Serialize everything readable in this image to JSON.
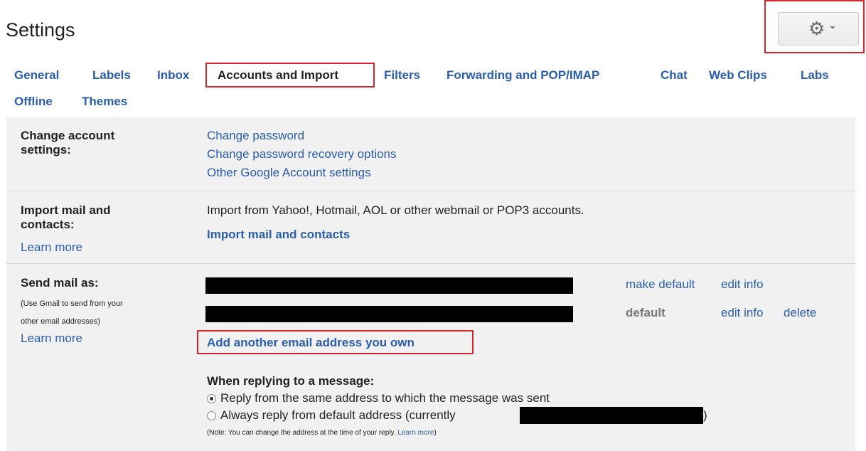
{
  "header": {
    "title": "Settings"
  },
  "nav": {
    "tabs": [
      "General",
      "Labels",
      "Inbox",
      "Accounts and Import",
      "Filters",
      "Forwarding and POP/IMAP",
      "Chat",
      "Web Clips",
      "Labs",
      "Offline",
      "Themes"
    ],
    "active": "Accounts and Import"
  },
  "change_account": {
    "label": "Change account settings:",
    "links": [
      "Change password",
      "Change password recovery options",
      "Other Google Account settings"
    ]
  },
  "import": {
    "label": "Import mail and contacts:",
    "learn_more": "Learn more",
    "description": "Import from Yahoo!, Hotmail, AOL or other webmail or POP3 accounts.",
    "action": "Import mail and contacts"
  },
  "send_as": {
    "label": "Send mail as:",
    "note_line1": "(Use Gmail to send from your",
    "note_line2": "other email addresses)",
    "learn_more": "Learn more",
    "row1": {
      "make_default": "make default",
      "edit_info": "edit info"
    },
    "row2": {
      "status": "default",
      "edit_info": "edit info",
      "delete": "delete"
    },
    "add_another": "Add another email address you own",
    "reply_heading": "When replying to a message:",
    "reply_option1": "Reply from the same address to which the message was sent",
    "reply_option2_prefix": "Always reply from default address (currently",
    "reply_option2_suffix": ")",
    "note_prefix": "(Note: You can change the address at the time of your reply. ",
    "note_link": "Learn more",
    "note_suffix": ")"
  },
  "colors": {
    "link": "#2a5db0",
    "highlight_box": "#d6262c",
    "panel_bg": "#f1f1f1"
  }
}
